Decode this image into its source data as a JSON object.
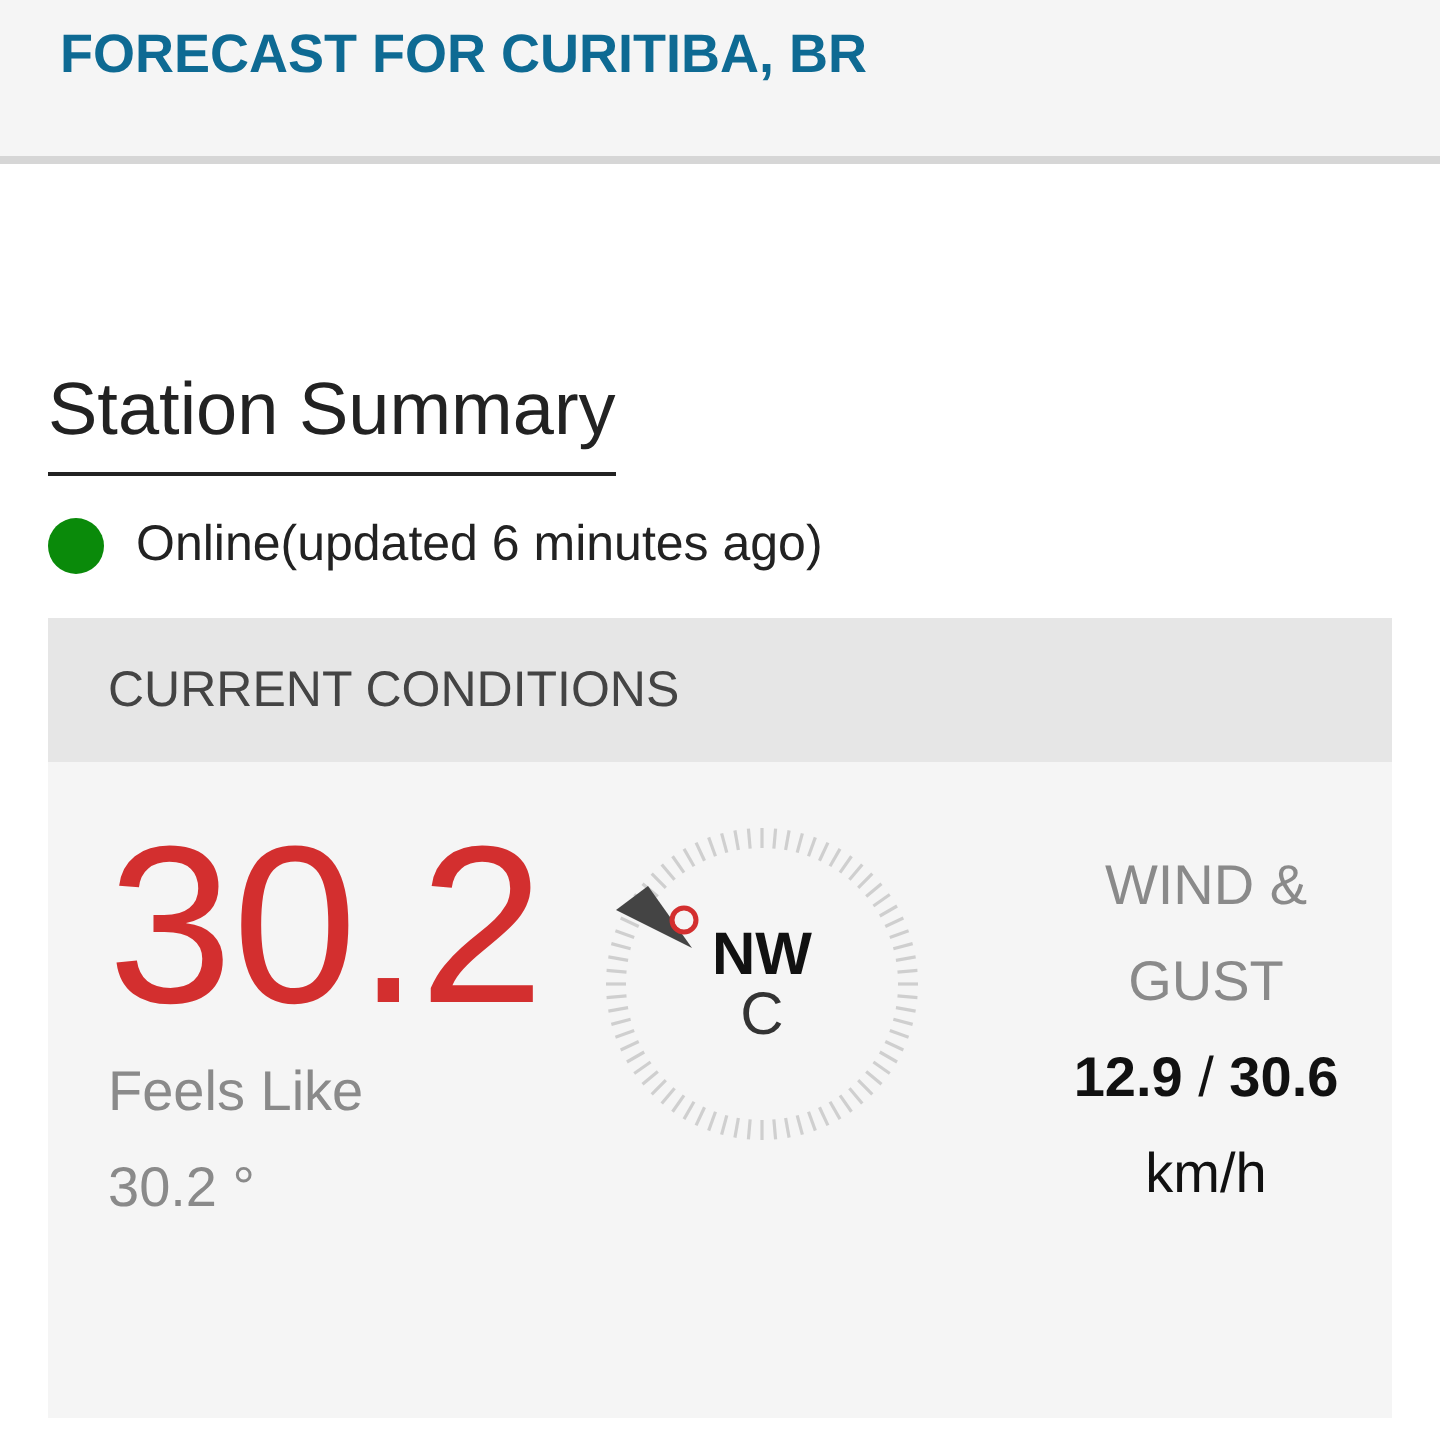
{
  "header": {
    "title": "FORECAST FOR CURITIBA, BR"
  },
  "section": {
    "title": "Station Summary"
  },
  "status": {
    "text": "Online(updated 6 minutes ago)",
    "color": "#0a8a0a"
  },
  "current_conditions": {
    "title": "CURRENT CONDITIONS",
    "temperature": "30.2",
    "feels_like_label": "Feels Like",
    "feels_like_value": "30.2 °",
    "compass": {
      "direction": "NW",
      "unit": "C"
    },
    "wind": {
      "label": "WIND & GUST",
      "reading": "**12.9**  / **30.6** km/h"
    }
  }
}
